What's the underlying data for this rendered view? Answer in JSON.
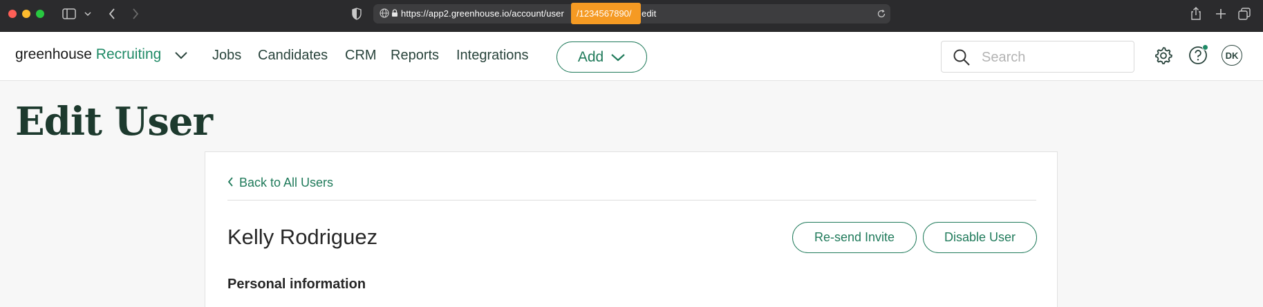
{
  "browser": {
    "url": "https://app2.greenhouse.io/account/user",
    "url_suffix": "edit",
    "url_highlight": "/1234567890/"
  },
  "header": {
    "brand_name": "greenhouse",
    "brand_product": "Recruiting",
    "nav": [
      "Jobs",
      "Candidates",
      "CRM",
      "Reports",
      "Integrations"
    ],
    "add_label": "Add",
    "search_placeholder": "Search",
    "avatar_initials": "DK"
  },
  "page": {
    "title": "Edit User",
    "back_link": "Back to All Users",
    "user_name": "Kelly Rodriguez",
    "resend_label": "Re-send Invite",
    "disable_label": "Disable User",
    "section_title": "Personal information"
  },
  "colors": {
    "accent": "#1f7a5a",
    "highlight": "#f59a23"
  }
}
